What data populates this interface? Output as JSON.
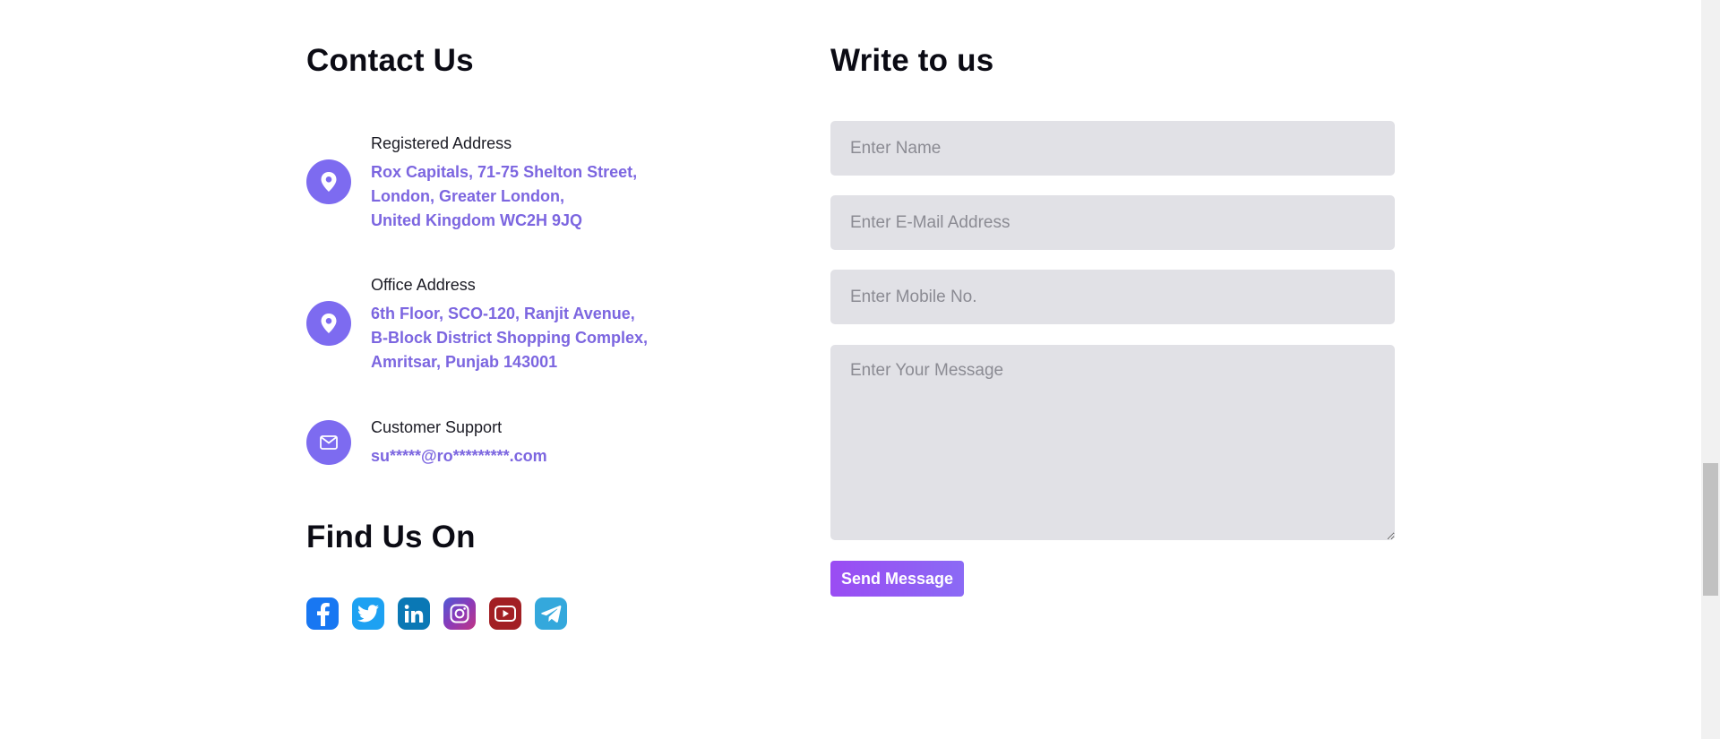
{
  "contact": {
    "title": "Contact Us",
    "items": [
      {
        "label": "Registered Address",
        "icon": "map-pin-icon",
        "lines": [
          "Rox Capitals, 71-75 Shelton Street,",
          "London, Greater London,",
          "United Kingdom WC2H 9JQ"
        ]
      },
      {
        "label": "Office Address",
        "icon": "map-pin-icon",
        "lines": [
          "6th Floor, SCO-120, Ranjit Avenue,",
          "B-Block District Shopping Complex,",
          "Amritsar, Punjab 143001"
        ]
      },
      {
        "label": "Customer Support",
        "icon": "envelope-icon",
        "lines": [
          "su*****@ro*********.com"
        ]
      }
    ]
  },
  "find_us": {
    "title": "Find Us On",
    "socials": [
      "facebook-icon",
      "twitter-icon",
      "linkedin-icon",
      "instagram-icon",
      "youtube-icon",
      "telegram-icon"
    ]
  },
  "form": {
    "title": "Write to us",
    "name_placeholder": "Enter Name",
    "email_placeholder": "Enter E-Mail Address",
    "mobile_placeholder": "Enter Mobile No.",
    "message_placeholder": "Enter Your Message",
    "send_label": "Send Message"
  },
  "colors": {
    "accent": "#7d6bf0",
    "accent_text": "#7c66e0",
    "field_bg": "#e1e1e6",
    "button_gradient_start": "#9a4cf3",
    "button_gradient_end": "#8b6af5"
  }
}
